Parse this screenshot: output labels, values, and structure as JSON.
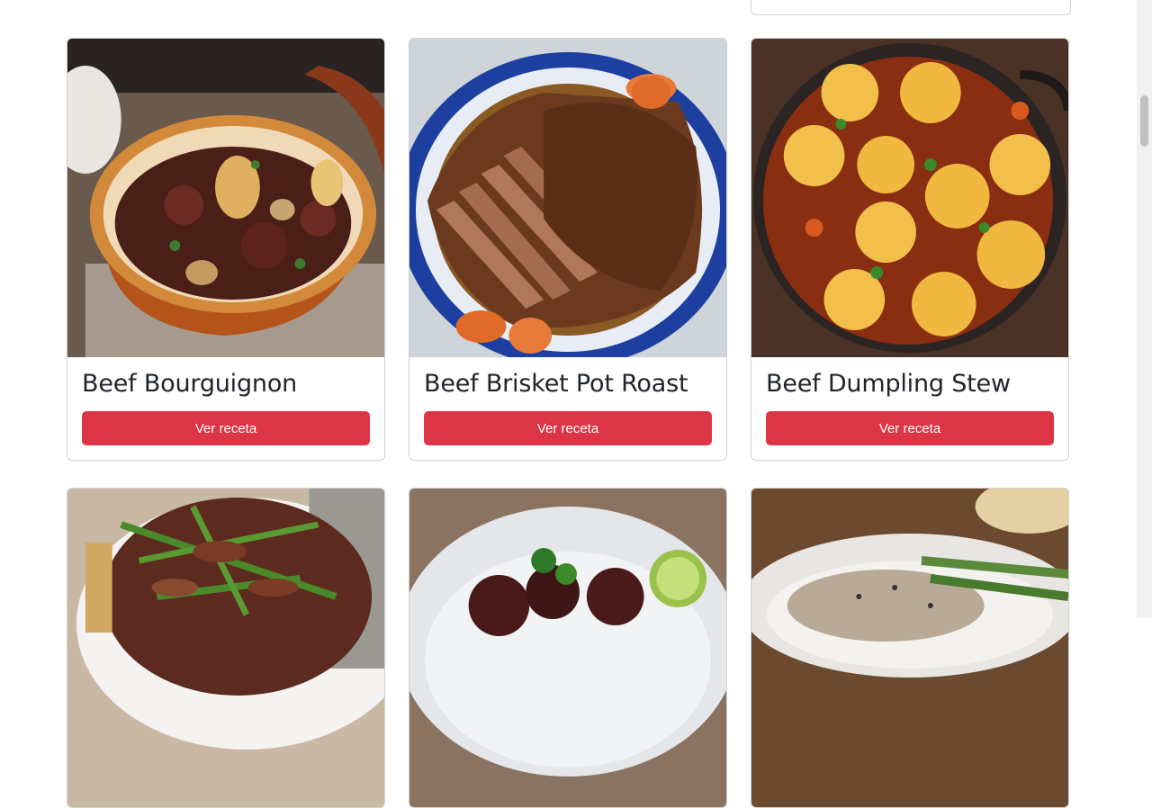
{
  "recipes_row1": [
    {
      "title": "Beef Bourguignon",
      "button": "Ver receta",
      "image": "beef-bourguignon-photo"
    },
    {
      "title": "Beef Brisket Pot Roast",
      "button": "Ver receta",
      "image": "beef-brisket-pot-roast-photo"
    },
    {
      "title": "Beef Dumpling Stew",
      "button": "Ver receta",
      "image": "beef-dumpling-stew-photo"
    }
  ],
  "recipes_row2": [
    {
      "image": "beef-asparagus-stir-fry-photo"
    },
    {
      "image": "beef-rice-lime-photo"
    },
    {
      "image": "beef-stroganoff-asparagus-photo"
    }
  ],
  "colors": {
    "accent": "#dc3545",
    "border": "#d9d9d9"
  }
}
